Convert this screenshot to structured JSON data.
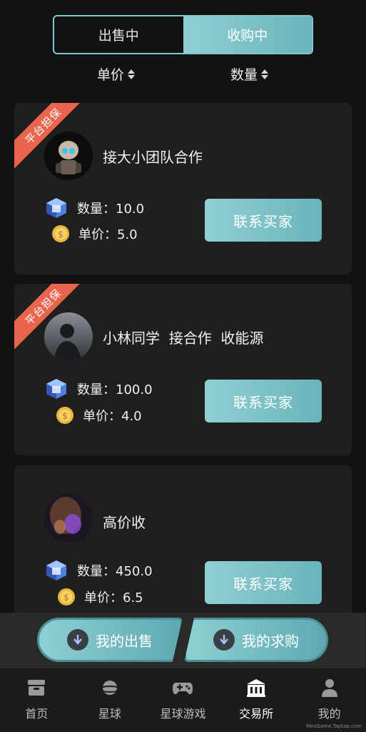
{
  "segmented": {
    "options": [
      "出售中",
      "收购中"
    ],
    "active_index": 1
  },
  "sort": {
    "price_label": "单价",
    "quantity_label": "数量"
  },
  "listings": [
    {
      "badge": "平台担保",
      "name": "接大小团队合作",
      "quantity_label": "数量：10.0",
      "price_label": "单价：5.0",
      "button": "联系买家"
    },
    {
      "badge": "平台担保",
      "name": "小林同学  接合作  收能源",
      "quantity_label": "数量：100.0",
      "price_label": "单价：4.0",
      "button": "联系买家"
    },
    {
      "badge": "",
      "name": "高价收",
      "quantity_label": "数量：450.0",
      "price_label": "单价：6.5",
      "button": "联系买家"
    }
  ],
  "actions": {
    "my_sales": "我的出售",
    "my_purchases": "我的求购"
  },
  "tabs": [
    {
      "label": "首页",
      "icon": "home-box-icon"
    },
    {
      "label": "星球",
      "icon": "planet-icon"
    },
    {
      "label": "星球游戏",
      "icon": "gamepad-icon"
    },
    {
      "label": "交易所",
      "icon": "exchange-building-icon",
      "active": true
    },
    {
      "label": "我的",
      "icon": "person-icon"
    }
  ],
  "watermark": "MiniGame.Taptap.com",
  "colors": {
    "accent": "#7fc7cd",
    "ribbon": "#e8644d",
    "card": "#1f1f1f",
    "background": "#121212"
  }
}
